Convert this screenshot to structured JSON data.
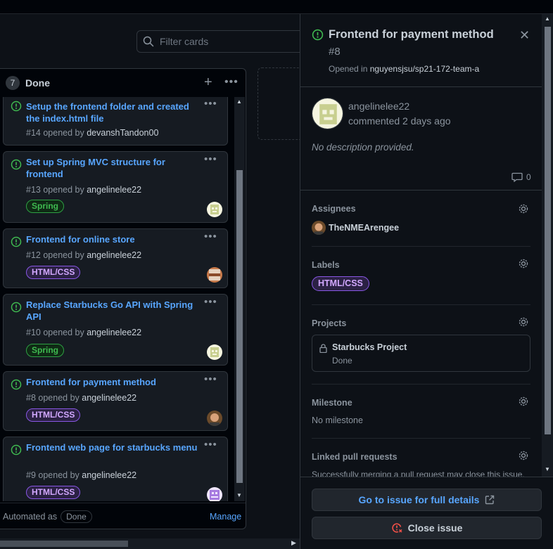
{
  "filter": {
    "placeholder": "Filter cards"
  },
  "column": {
    "count": "7",
    "title": "Done",
    "add_icon": "plus-icon",
    "more_icon": "kebab-horizontal-icon",
    "automated_text": "Automated as",
    "automated_value": "Done",
    "manage_label": "Manage"
  },
  "cards": [
    {
      "title": "Setup the frontend folder and created the index.html file",
      "number": "#14",
      "opened_by": "opened by",
      "author": "devanshTandon00",
      "label": ""
    },
    {
      "title": "Set up Spring MVC structure for frontend",
      "number": "#13",
      "opened_by": "opened by",
      "author": "angelinelee22",
      "label": "Spring"
    },
    {
      "title": "Frontend for online store",
      "number": "#12",
      "opened_by": "opened by",
      "author": "angelinelee22",
      "label": "HTML/CSS"
    },
    {
      "title": "Replace Starbucks Go API with Spring API",
      "number": "#10",
      "opened_by": "opened by",
      "author": "angelinelee22",
      "label": "Spring"
    },
    {
      "title": "Frontend for payment method",
      "number": "#8",
      "opened_by": "opened by",
      "author": "angelinelee22",
      "label": "HTML/CSS"
    },
    {
      "title": "Frontend web page for starbucks menu",
      "number": "#9",
      "opened_by": "opened by",
      "author": "angelinelee22",
      "label": "HTML/CSS"
    }
  ],
  "panel": {
    "title": "Frontend for payment method",
    "number": "#8",
    "opened_in": "Opened in",
    "repo": "nguyensjsu/sp21-172-team-a",
    "author": "angelinelee22",
    "commented": "commented 2 days ago",
    "no_description": "No description provided.",
    "comment_count": "0",
    "assignees_title": "Assignees",
    "assignee_name": "TheNMEArengee",
    "labels_title": "Labels",
    "label": "HTML/CSS",
    "projects_title": "Projects",
    "project_name": "Starbucks Project",
    "project_status": "Done",
    "milestone_title": "Milestone",
    "milestone_value": "No milestone",
    "linked_title": "Linked pull requests",
    "linked_note": "Successfully merging a pull request may close this issue.",
    "go_button": "Go to issue for full details",
    "close_button": "Close issue"
  },
  "colors": {
    "background": "#0d1117",
    "link": "#58a6ff",
    "open_issue": "#3fb950",
    "spring_label": "#3fb950",
    "html_label": "#d2a8ff",
    "close_icon": "#f85149"
  }
}
